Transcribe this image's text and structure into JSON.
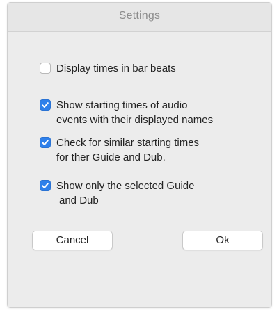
{
  "dialog": {
    "title": "Settings"
  },
  "options": [
    {
      "lines": [
        "Display times in bar beats"
      ],
      "checked": false
    },
    {
      "lines": [
        "Show starting times of audio",
        "events with their displayed names"
      ],
      "checked": true
    },
    {
      "lines": [
        "Check for similar starting times",
        "for ther Guide and Dub."
      ],
      "checked": true
    },
    {
      "lines": [
        "Show only the selected Guide",
        "and Dub"
      ],
      "checked": true
    }
  ],
  "buttons": {
    "cancel_label": "Cancel",
    "ok_label": "Ok"
  },
  "colors": {
    "accent": "#2f80ea",
    "dialog_bg": "#ececec"
  }
}
